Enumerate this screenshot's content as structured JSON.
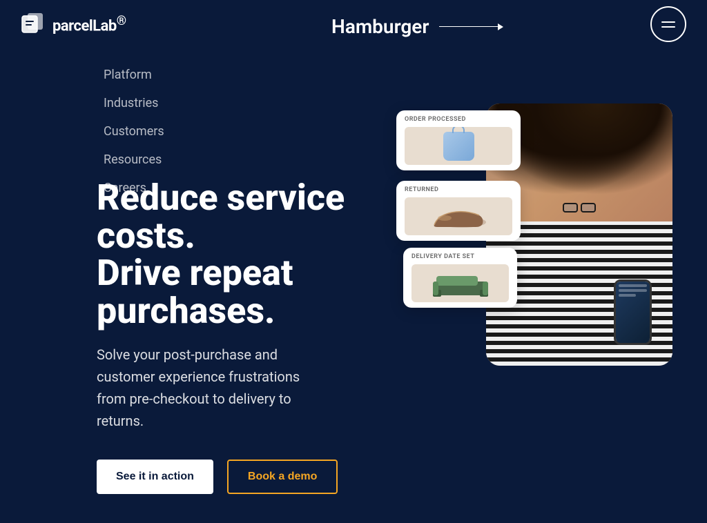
{
  "brand": {
    "name": "parcelLab",
    "sup": "®"
  },
  "header": {
    "hamburger_label": "Hamburger",
    "hamburger_btn_label": "Menu"
  },
  "nav": {
    "items": [
      {
        "label": "Platform",
        "id": "platform"
      },
      {
        "label": "Industries",
        "id": "industries"
      },
      {
        "label": "Customers",
        "id": "customers"
      },
      {
        "label": "Resources",
        "id": "resources"
      },
      {
        "label": "Careers",
        "id": "careers"
      }
    ]
  },
  "hero": {
    "headline_line1": "Reduce service",
    "headline_line2": "costs.",
    "headline_line3": "Drive repeat",
    "headline_line4": "purchases.",
    "subheadline": "Solve your post-purchase and customer experience frustrations from pre-checkout to delivery to returns.",
    "cta_primary": "See it in action",
    "cta_secondary": "Book a demo"
  },
  "status_cards": [
    {
      "label": "ORDER PROCESSED",
      "type": "bag"
    },
    {
      "label": "RETURNED",
      "type": "shoe"
    },
    {
      "label": "DELIVERY DATE SET",
      "type": "furniture"
    }
  ],
  "colors": {
    "background": "#0a1a3a",
    "text_primary": "#ffffff",
    "text_muted": "rgba(255,255,255,0.7)",
    "btn_outline_color": "#f5a623",
    "accent": "#f5a623"
  }
}
